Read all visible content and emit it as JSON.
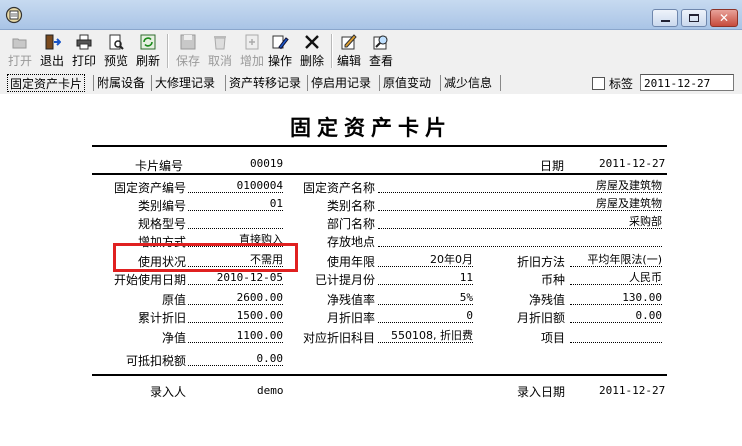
{
  "window": {
    "icon": "app-icon"
  },
  "toolbar": {
    "buttons": [
      {
        "label": "打开",
        "icon": "open-icon",
        "enabled": false
      },
      {
        "label": "退出",
        "icon": "exit-icon",
        "enabled": true
      },
      {
        "label": "打印",
        "icon": "print-icon",
        "enabled": true
      },
      {
        "label": "预览",
        "icon": "preview-icon",
        "enabled": true
      },
      {
        "label": "刷新",
        "icon": "refresh-icon",
        "enabled": true
      },
      {
        "label": "保存",
        "icon": "save-icon",
        "enabled": false
      },
      {
        "label": "取消",
        "icon": "cancel-icon",
        "enabled": false
      },
      {
        "label": "增加",
        "icon": "add-icon",
        "enabled": false
      },
      {
        "label": "操作",
        "icon": "edit-operate-icon",
        "enabled": true
      },
      {
        "label": "删除",
        "icon": "delete-icon",
        "enabled": true
      },
      {
        "label": "编辑",
        "icon": "edit-icon",
        "enabled": true
      },
      {
        "label": "查看",
        "icon": "view-icon",
        "enabled": true
      }
    ]
  },
  "tabs": [
    "固定资产卡片",
    "附属设备",
    "大修理记录",
    "资产转移记录",
    "停启用记录",
    "原值变动",
    "减少信息"
  ],
  "tag_label": "标签",
  "tag_date": "2011-12-27",
  "card": {
    "title": "固定资产卡片",
    "card_no_label": "卡片编号",
    "card_no": "00019",
    "date_label": "日期",
    "date": "2011-12-27",
    "asset_no_label": "固定资产编号",
    "asset_no": "0100004",
    "asset_name_label": "固定资产名称",
    "asset_name": "房屋及建筑物",
    "category_no_label": "类别编号",
    "category_no": "01",
    "category_name_label": "类别名称",
    "category_name": "房屋及建筑物",
    "spec_label": "规格型号",
    "spec": "",
    "dept_label": "部门名称",
    "dept": "采购部",
    "add_method_label": "增加方式",
    "add_method": "直接购入",
    "location_label": "存放地点",
    "location": "",
    "status_label": "使用状况",
    "status": "不需用",
    "life_label": "使用年限",
    "life": "20年0月",
    "method_label": "折旧方法",
    "method": "平均年限法(一)",
    "start_label": "开始使用日期",
    "start": "2010-12-05",
    "months_label": "已计提月份",
    "months": "11",
    "currency_label": "币种",
    "currency": "人民币",
    "orig_label": "原值",
    "orig": "2600.00",
    "salvage_rate_label": "净残值率",
    "salvage_rate": "5%",
    "salvage_label": "净残值",
    "salvage": "130.00",
    "accum_label": "累计折旧",
    "accum": "1500.00",
    "mrate_label": "月折旧率",
    "mrate": "0",
    "mamount_label": "月折旧额",
    "mamount": "0.00",
    "net_label": "净值",
    "net": "1100.00",
    "subject_label": "对应折旧科目",
    "subject": "550108, 折旧费",
    "item_label": "项目",
    "item": "",
    "tax_label": "可抵扣税额",
    "tax": "0.00",
    "entrant_label": "录入人",
    "entrant": "demo",
    "entry_date_label": "录入日期",
    "entry_date": "2011-12-27"
  },
  "highlight_color": "#e02020"
}
